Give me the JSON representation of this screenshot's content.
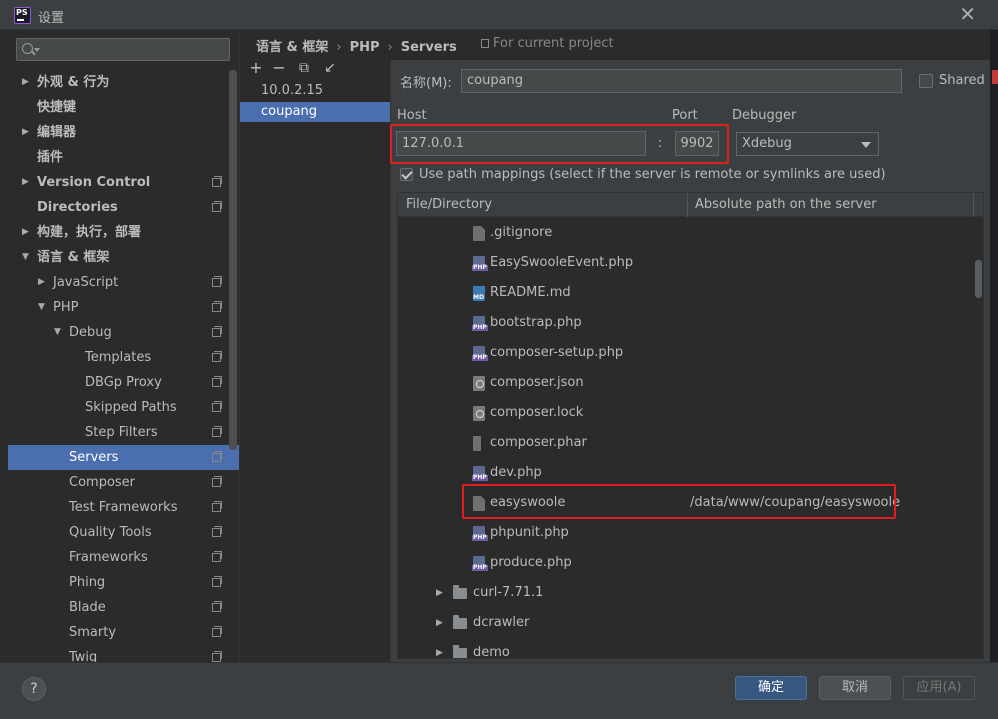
{
  "window": {
    "title": "设置"
  },
  "search": {
    "placeholder": ""
  },
  "tree": [
    {
      "label": "外观 & 行为",
      "level": 0,
      "arrow": "right",
      "bold": true,
      "project": false
    },
    {
      "label": "快捷键",
      "level": 0,
      "arrow": "none",
      "bold": true,
      "project": false
    },
    {
      "label": "编辑器",
      "level": 0,
      "arrow": "right",
      "bold": true,
      "project": false
    },
    {
      "label": "插件",
      "level": 0,
      "arrow": "none",
      "bold": true,
      "project": false
    },
    {
      "label": "Version Control",
      "level": 0,
      "arrow": "right",
      "bold": true,
      "project": true
    },
    {
      "label": "Directories",
      "level": 0,
      "arrow": "none",
      "bold": true,
      "project": true
    },
    {
      "label": "构建，执行，部署",
      "level": 0,
      "arrow": "right",
      "bold": true,
      "project": false
    },
    {
      "label": "语言 & 框架",
      "level": 0,
      "arrow": "down",
      "bold": true,
      "project": false
    },
    {
      "label": "JavaScript",
      "level": 1,
      "arrow": "right",
      "bold": false,
      "project": true
    },
    {
      "label": "PHP",
      "level": 1,
      "arrow": "down",
      "bold": false,
      "project": true
    },
    {
      "label": "Debug",
      "level": 2,
      "arrow": "down",
      "bold": false,
      "project": true
    },
    {
      "label": "Templates",
      "level": 3,
      "arrow": "none",
      "bold": false,
      "project": true
    },
    {
      "label": "DBGp Proxy",
      "level": 3,
      "arrow": "none",
      "bold": false,
      "project": true
    },
    {
      "label": "Skipped Paths",
      "level": 3,
      "arrow": "none",
      "bold": false,
      "project": true
    },
    {
      "label": "Step Filters",
      "level": 3,
      "arrow": "none",
      "bold": false,
      "project": true
    },
    {
      "label": "Servers",
      "level": 2,
      "arrow": "none",
      "bold": false,
      "project": true,
      "selected": true
    },
    {
      "label": "Composer",
      "level": 2,
      "arrow": "none",
      "bold": false,
      "project": true
    },
    {
      "label": "Test Frameworks",
      "level": 2,
      "arrow": "none",
      "bold": false,
      "project": true
    },
    {
      "label": "Quality Tools",
      "level": 2,
      "arrow": "none",
      "bold": false,
      "project": true
    },
    {
      "label": "Frameworks",
      "level": 2,
      "arrow": "none",
      "bold": false,
      "project": true
    },
    {
      "label": "Phing",
      "level": 2,
      "arrow": "none",
      "bold": false,
      "project": true
    },
    {
      "label": "Blade",
      "level": 2,
      "arrow": "none",
      "bold": false,
      "project": true
    },
    {
      "label": "Smarty",
      "level": 2,
      "arrow": "none",
      "bold": false,
      "project": true
    },
    {
      "label": "Twig",
      "level": 2,
      "arrow": "none",
      "bold": false,
      "project": true
    }
  ],
  "breadcrumb": {
    "part1": "语言 & 框架",
    "part2": "PHP",
    "part3": "Servers",
    "separator": "›"
  },
  "for_project": "For current project",
  "toolbar": {
    "add": "+",
    "remove": "−",
    "copy": "⧉",
    "import": "↙"
  },
  "servers": [
    {
      "label": "10.0.2.15",
      "selected": false
    },
    {
      "label": "coupang",
      "selected": true
    }
  ],
  "form": {
    "name_label": "名称(M)",
    "name_label_colon": ":",
    "name_value": "coupang",
    "shared_label": "Shared",
    "host_label": "Host",
    "port_label": "Port",
    "debugger_label": "Debugger",
    "host_value": "127.0.0.1",
    "colon": ":",
    "port_value": "9902",
    "debugger_value": "Xdebug",
    "use_path_mappings_label": "Use path mappings (select if the server is remote or symlinks are used)"
  },
  "mappings": {
    "col_file": "File/Directory",
    "col_path": "Absolute path on the server",
    "rows": [
      {
        "name": ".gitignore",
        "icon": "file",
        "indent": 2,
        "arrow": "none",
        "path": ""
      },
      {
        "name": "EasySwooleEvent.php",
        "icon": "php",
        "indent": 2,
        "arrow": "none",
        "path": ""
      },
      {
        "name": "README.md",
        "icon": "md",
        "indent": 2,
        "arrow": "none",
        "path": ""
      },
      {
        "name": "bootstrap.php",
        "icon": "php",
        "indent": 2,
        "arrow": "none",
        "path": ""
      },
      {
        "name": "composer-setup.php",
        "icon": "php",
        "indent": 2,
        "arrow": "none",
        "path": ""
      },
      {
        "name": "composer.json",
        "icon": "json",
        "indent": 2,
        "arrow": "none",
        "path": ""
      },
      {
        "name": "composer.lock",
        "icon": "json",
        "indent": 2,
        "arrow": "none",
        "path": ""
      },
      {
        "name": "composer.phar",
        "icon": "phar",
        "indent": 2,
        "arrow": "none",
        "path": ""
      },
      {
        "name": "dev.php",
        "icon": "php",
        "indent": 2,
        "arrow": "none",
        "path": ""
      },
      {
        "name": "easyswoole",
        "icon": "file",
        "indent": 2,
        "arrow": "none",
        "path": "/data/www/coupang/easyswoole"
      },
      {
        "name": "phpunit.php",
        "icon": "php",
        "indent": 2,
        "arrow": "none",
        "path": ""
      },
      {
        "name": "produce.php",
        "icon": "php",
        "indent": 2,
        "arrow": "none",
        "path": ""
      },
      {
        "name": "curl-7.71.1",
        "icon": "folder",
        "indent": 1,
        "arrow": "right",
        "path": ""
      },
      {
        "name": "dcrawler",
        "icon": "folder",
        "indent": 1,
        "arrow": "right",
        "path": ""
      },
      {
        "name": "demo",
        "icon": "folder",
        "indent": 1,
        "arrow": "right",
        "path": ""
      }
    ]
  },
  "buttons": {
    "help": "?",
    "ok": "确定",
    "cancel": "取消",
    "apply": "应用(A)"
  },
  "colors": {
    "selection": "#4b6eaf",
    "highlight": "#e02020",
    "primary": "#365880"
  }
}
